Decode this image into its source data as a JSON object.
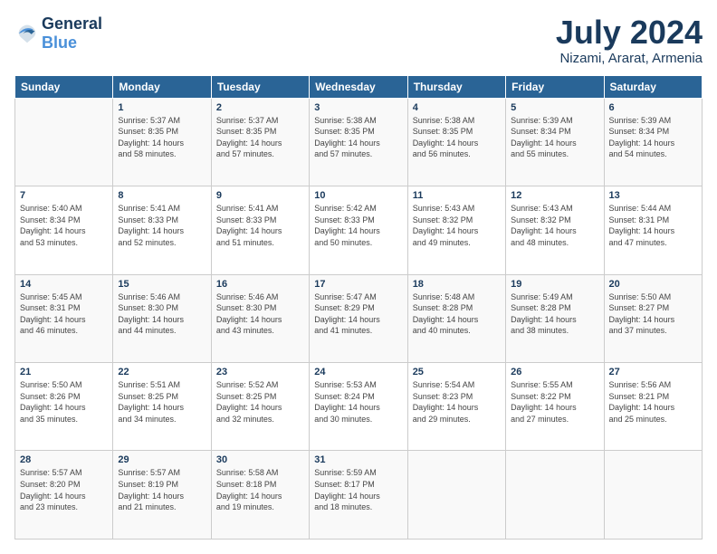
{
  "header": {
    "logo_text_general": "General",
    "logo_text_blue": "Blue",
    "month_year": "July 2024",
    "location": "Nizami, Ararat, Armenia"
  },
  "days_of_week": [
    "Sunday",
    "Monday",
    "Tuesday",
    "Wednesday",
    "Thursday",
    "Friday",
    "Saturday"
  ],
  "weeks": [
    [
      {
        "day": "",
        "content": ""
      },
      {
        "day": "1",
        "content": "Sunrise: 5:37 AM\nSunset: 8:35 PM\nDaylight: 14 hours\nand 58 minutes."
      },
      {
        "day": "2",
        "content": "Sunrise: 5:37 AM\nSunset: 8:35 PM\nDaylight: 14 hours\nand 57 minutes."
      },
      {
        "day": "3",
        "content": "Sunrise: 5:38 AM\nSunset: 8:35 PM\nDaylight: 14 hours\nand 57 minutes."
      },
      {
        "day": "4",
        "content": "Sunrise: 5:38 AM\nSunset: 8:35 PM\nDaylight: 14 hours\nand 56 minutes."
      },
      {
        "day": "5",
        "content": "Sunrise: 5:39 AM\nSunset: 8:34 PM\nDaylight: 14 hours\nand 55 minutes."
      },
      {
        "day": "6",
        "content": "Sunrise: 5:39 AM\nSunset: 8:34 PM\nDaylight: 14 hours\nand 54 minutes."
      }
    ],
    [
      {
        "day": "7",
        "content": "Sunrise: 5:40 AM\nSunset: 8:34 PM\nDaylight: 14 hours\nand 53 minutes."
      },
      {
        "day": "8",
        "content": "Sunrise: 5:41 AM\nSunset: 8:33 PM\nDaylight: 14 hours\nand 52 minutes."
      },
      {
        "day": "9",
        "content": "Sunrise: 5:41 AM\nSunset: 8:33 PM\nDaylight: 14 hours\nand 51 minutes."
      },
      {
        "day": "10",
        "content": "Sunrise: 5:42 AM\nSunset: 8:33 PM\nDaylight: 14 hours\nand 50 minutes."
      },
      {
        "day": "11",
        "content": "Sunrise: 5:43 AM\nSunset: 8:32 PM\nDaylight: 14 hours\nand 49 minutes."
      },
      {
        "day": "12",
        "content": "Sunrise: 5:43 AM\nSunset: 8:32 PM\nDaylight: 14 hours\nand 48 minutes."
      },
      {
        "day": "13",
        "content": "Sunrise: 5:44 AM\nSunset: 8:31 PM\nDaylight: 14 hours\nand 47 minutes."
      }
    ],
    [
      {
        "day": "14",
        "content": "Sunrise: 5:45 AM\nSunset: 8:31 PM\nDaylight: 14 hours\nand 46 minutes."
      },
      {
        "day": "15",
        "content": "Sunrise: 5:46 AM\nSunset: 8:30 PM\nDaylight: 14 hours\nand 44 minutes."
      },
      {
        "day": "16",
        "content": "Sunrise: 5:46 AM\nSunset: 8:30 PM\nDaylight: 14 hours\nand 43 minutes."
      },
      {
        "day": "17",
        "content": "Sunrise: 5:47 AM\nSunset: 8:29 PM\nDaylight: 14 hours\nand 41 minutes."
      },
      {
        "day": "18",
        "content": "Sunrise: 5:48 AM\nSunset: 8:28 PM\nDaylight: 14 hours\nand 40 minutes."
      },
      {
        "day": "19",
        "content": "Sunrise: 5:49 AM\nSunset: 8:28 PM\nDaylight: 14 hours\nand 38 minutes."
      },
      {
        "day": "20",
        "content": "Sunrise: 5:50 AM\nSunset: 8:27 PM\nDaylight: 14 hours\nand 37 minutes."
      }
    ],
    [
      {
        "day": "21",
        "content": "Sunrise: 5:50 AM\nSunset: 8:26 PM\nDaylight: 14 hours\nand 35 minutes."
      },
      {
        "day": "22",
        "content": "Sunrise: 5:51 AM\nSunset: 8:25 PM\nDaylight: 14 hours\nand 34 minutes."
      },
      {
        "day": "23",
        "content": "Sunrise: 5:52 AM\nSunset: 8:25 PM\nDaylight: 14 hours\nand 32 minutes."
      },
      {
        "day": "24",
        "content": "Sunrise: 5:53 AM\nSunset: 8:24 PM\nDaylight: 14 hours\nand 30 minutes."
      },
      {
        "day": "25",
        "content": "Sunrise: 5:54 AM\nSunset: 8:23 PM\nDaylight: 14 hours\nand 29 minutes."
      },
      {
        "day": "26",
        "content": "Sunrise: 5:55 AM\nSunset: 8:22 PM\nDaylight: 14 hours\nand 27 minutes."
      },
      {
        "day": "27",
        "content": "Sunrise: 5:56 AM\nSunset: 8:21 PM\nDaylight: 14 hours\nand 25 minutes."
      }
    ],
    [
      {
        "day": "28",
        "content": "Sunrise: 5:57 AM\nSunset: 8:20 PM\nDaylight: 14 hours\nand 23 minutes."
      },
      {
        "day": "29",
        "content": "Sunrise: 5:57 AM\nSunset: 8:19 PM\nDaylight: 14 hours\nand 21 minutes."
      },
      {
        "day": "30",
        "content": "Sunrise: 5:58 AM\nSunset: 8:18 PM\nDaylight: 14 hours\nand 19 minutes."
      },
      {
        "day": "31",
        "content": "Sunrise: 5:59 AM\nSunset: 8:17 PM\nDaylight: 14 hours\nand 18 minutes."
      },
      {
        "day": "",
        "content": ""
      },
      {
        "day": "",
        "content": ""
      },
      {
        "day": "",
        "content": ""
      }
    ]
  ]
}
